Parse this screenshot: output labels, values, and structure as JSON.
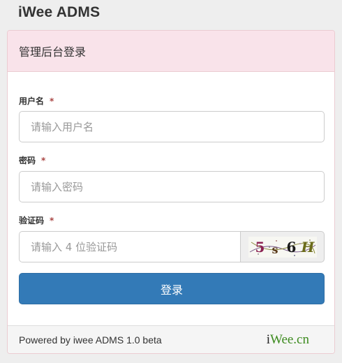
{
  "brand": "iWee ADMS",
  "panel": {
    "title": "管理后台登录"
  },
  "form": {
    "username": {
      "label": "用户名",
      "required_mark": "*",
      "placeholder": "请输入用户名"
    },
    "password": {
      "label": "密码",
      "required_mark": "*",
      "placeholder": "请输入密码"
    },
    "captcha": {
      "label": "验证码",
      "required_mark": "*",
      "placeholder": "请输入 4 位验证码",
      "chars": [
        "5",
        "s",
        "6",
        "H"
      ],
      "char_colors": [
        "#8b2252",
        "#5a3a1a",
        "#1a1a1a",
        "#6b6b1a"
      ]
    },
    "submit_label": "登录"
  },
  "footer": {
    "powered_by": "Powered by iwee ADMS 1.0 beta",
    "logo_i": "i",
    "logo_rest": "Wee.cn"
  },
  "colors": {
    "primary": "#337ab7",
    "heading_bg": "#f9e3ea",
    "required": "#a94442",
    "logo_green": "#3d8b1f"
  }
}
